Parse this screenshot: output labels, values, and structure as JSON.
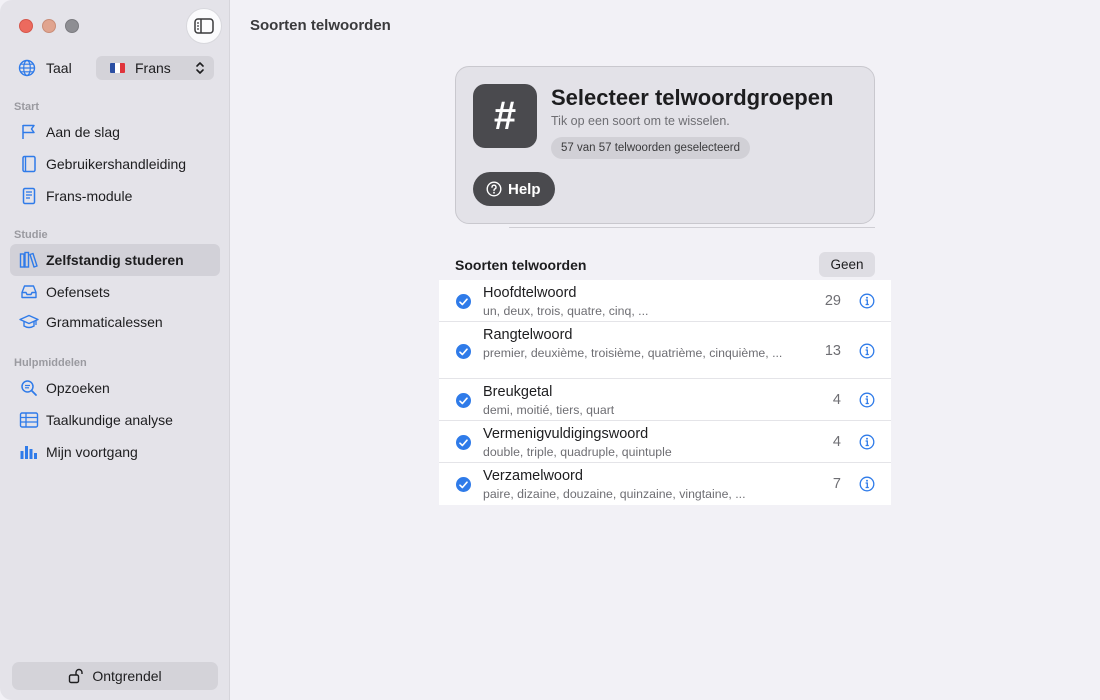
{
  "sidebar": {
    "language_label": "Taal",
    "language_value": "Frans",
    "sections": [
      {
        "title": "Start"
      },
      {
        "title": "Studie"
      },
      {
        "title": "Hulpmiddelen"
      }
    ],
    "items": [
      {
        "label": "Aan de slag",
        "icon": "flag-icon"
      },
      {
        "label": "Gebruikershandleiding",
        "icon": "book-icon"
      },
      {
        "label": "Frans-module",
        "icon": "document-icon"
      },
      {
        "label": "Zelfstandig studeren",
        "icon": "books-icon",
        "active": true
      },
      {
        "label": "Oefensets",
        "icon": "tray-icon"
      },
      {
        "label": "Grammaticalessen",
        "icon": "graduation-cap-icon"
      },
      {
        "label": "Opzoeken",
        "icon": "magnifier-icon"
      },
      {
        "label": "Taalkundige analyse",
        "icon": "table-icon"
      },
      {
        "label": "Mijn voortgang",
        "icon": "bar-chart-icon"
      }
    ],
    "unlock_label": "Ontgrendel"
  },
  "main": {
    "title": "Soorten telwoorden",
    "hero": {
      "symbol": "#",
      "title": "Selecteer telwoordgroepen",
      "subtitle": "Tik op een soort om te wisselen.",
      "badge": "57 van 57 telwoorden geselecteerd",
      "help_label": "Help"
    },
    "list_title": "Soorten telwoorden",
    "none_label": "Geen",
    "rows": [
      {
        "name": "Hoofdtelwoord",
        "examples": "un, deux, trois, quatre, cinq, ...",
        "count": "29",
        "checked": true
      },
      {
        "name": "Rangtelwoord",
        "examples": "premier, deuxième, troisième, quatrième, cinquième, ...",
        "count": "13",
        "checked": true
      },
      {
        "name": "Breukgetal",
        "examples": "demi, moitié, tiers, quart",
        "count": "4",
        "checked": true
      },
      {
        "name": "Vermenigvuldigingswoord",
        "examples": "double, triple, quadruple, quintuple",
        "count": "4",
        "checked": true
      },
      {
        "name": "Verzamelwoord",
        "examples": "paire, dizaine, douzaine, quinzaine, vingtaine, ...",
        "count": "7",
        "checked": true
      }
    ]
  },
  "colors": {
    "accent": "#2f7be9",
    "dark_button": "#4a4a4e",
    "sidebar_bg": "#e4e3e9",
    "content_bg": "#f2f1f6"
  }
}
